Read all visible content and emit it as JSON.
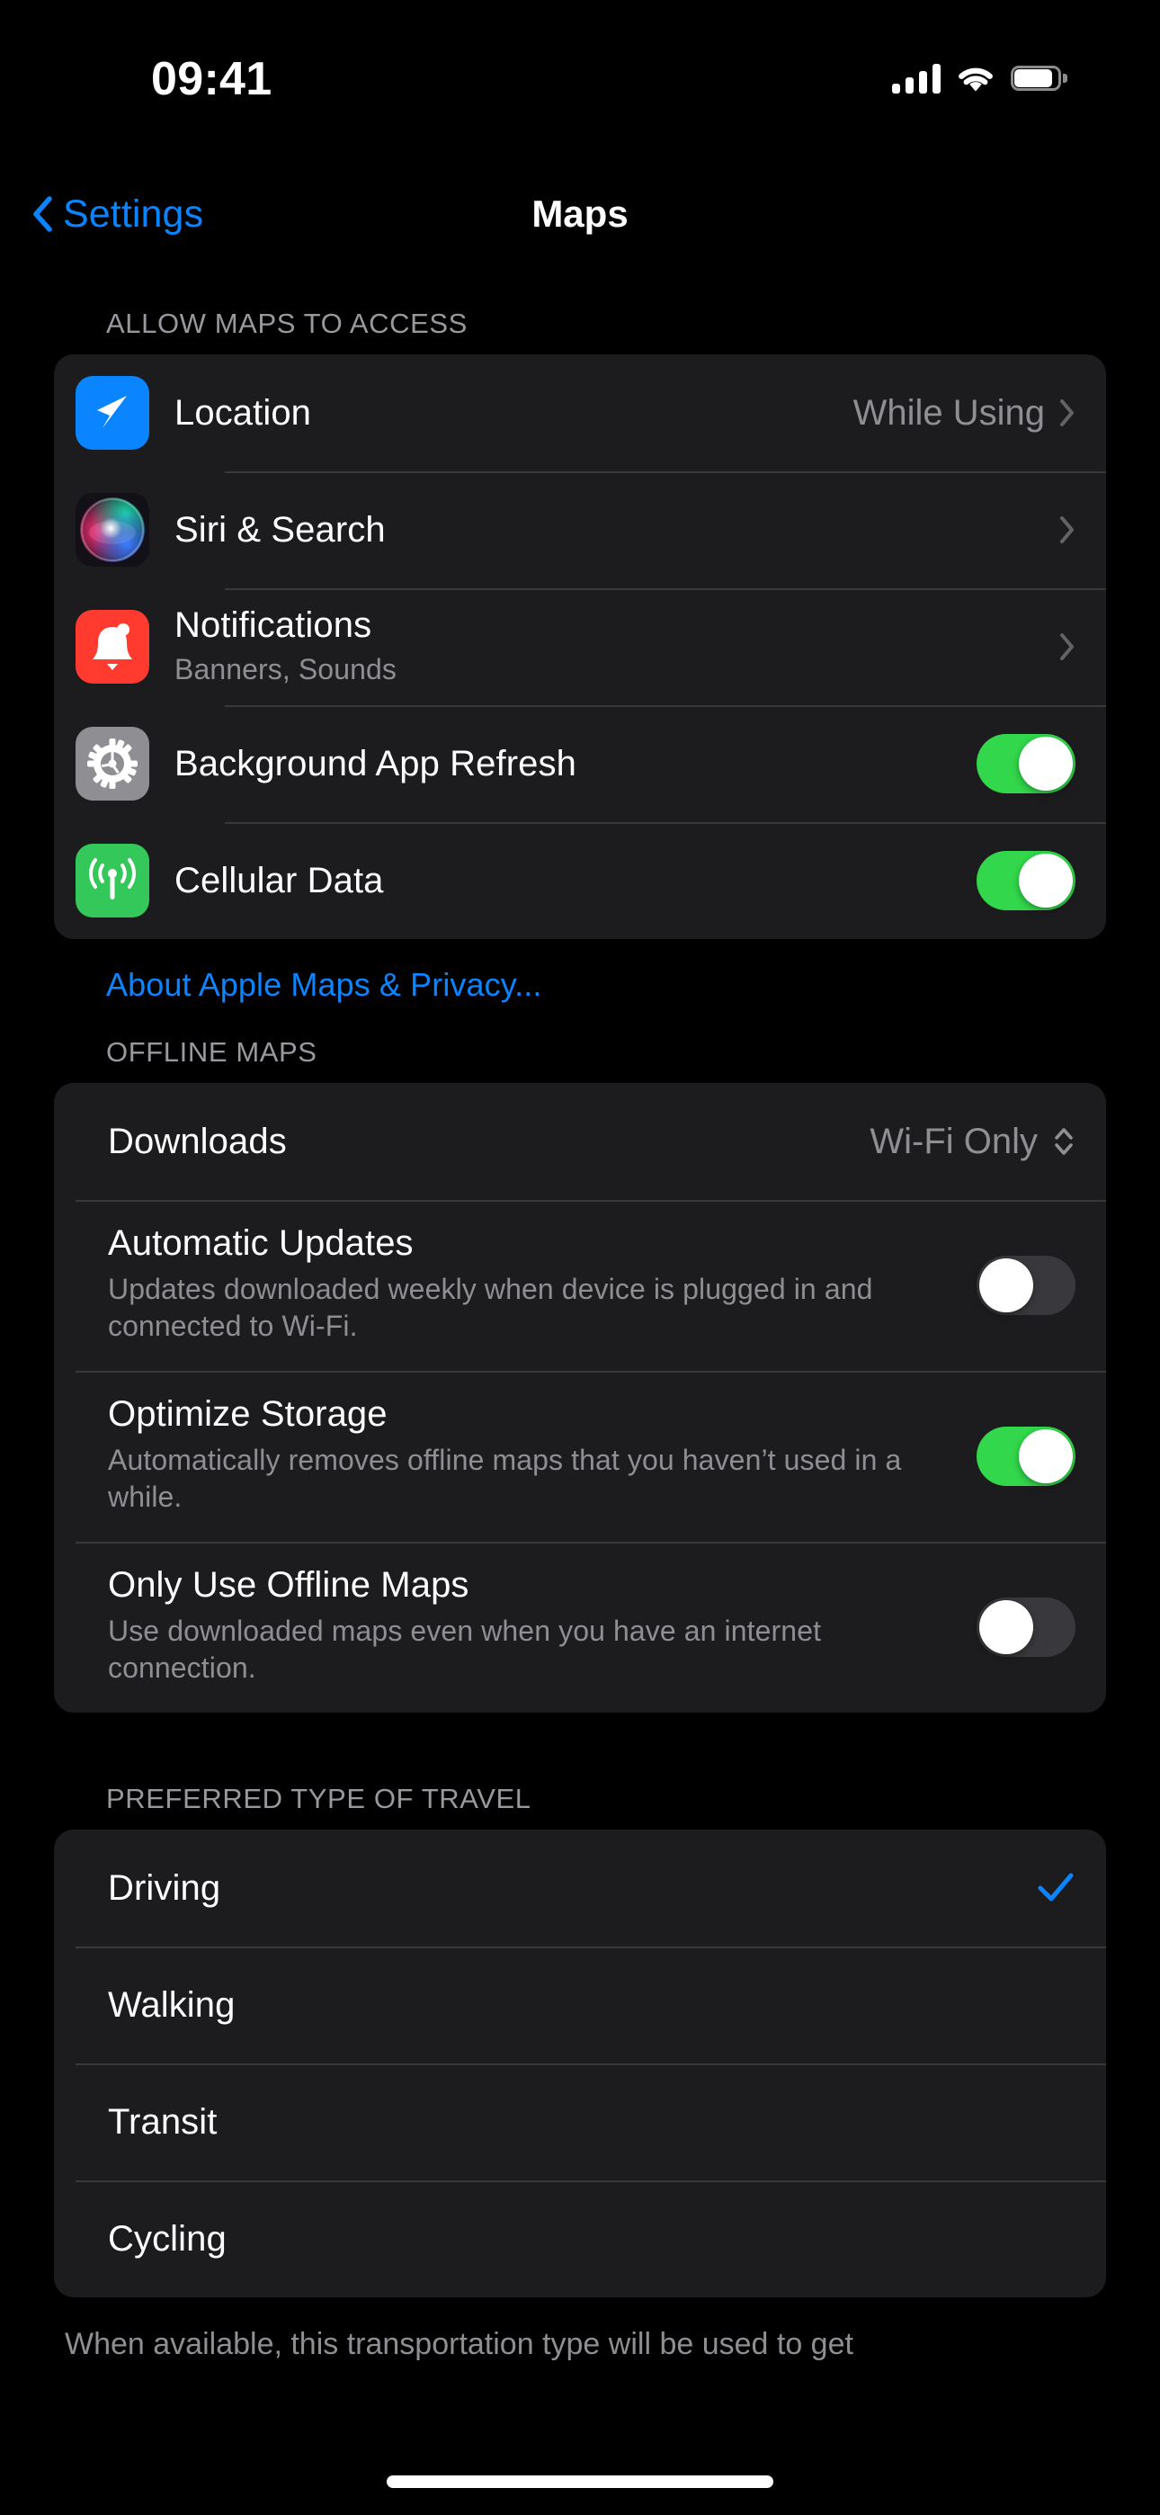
{
  "status_bar": {
    "time": "09:41",
    "cellular_icon": "cellular-signal-icon",
    "wifi_icon": "wifi-icon",
    "battery_icon": "battery-icon"
  },
  "nav": {
    "back_label": "Settings",
    "back_icon": "chevron-left-icon",
    "title": "Maps"
  },
  "colors": {
    "accent_blue": "#0a84ff",
    "toggle_on_green": "#32d74b",
    "toggle_off_gray": "#39393d",
    "card_background": "#1c1c1e",
    "page_background": "#000000",
    "secondary_text": "#8e8e93",
    "header_text": "#98989e"
  },
  "sections": {
    "allow_access": {
      "header": "ALLOW MAPS TO ACCESS",
      "rows": [
        {
          "title": "Location",
          "value": "While Using",
          "icon": "location-arrow-icon",
          "accessory": "chevron-right-icon"
        },
        {
          "title": "Siri & Search",
          "icon": "siri-orb-icon",
          "accessory": "chevron-right-icon"
        },
        {
          "title": "Notifications",
          "subtitle": "Banners, Sounds",
          "icon": "bell-icon",
          "accessory": "chevron-right-icon"
        },
        {
          "title": "Background App Refresh",
          "icon": "gear-icon",
          "accessory": "toggle",
          "toggle_on": true
        },
        {
          "title": "Cellular Data",
          "icon": "cellular-antenna-icon",
          "accessory": "toggle",
          "toggle_on": true
        }
      ],
      "privacy_link": "About Apple Maps & Privacy..."
    },
    "offline_maps": {
      "header": "OFFLINE MAPS",
      "rows": [
        {
          "title": "Downloads",
          "value": "Wi-Fi Only",
          "accessory": "up-down-chevron-icon"
        },
        {
          "title": "Automatic Updates",
          "subtitle": "Updates downloaded weekly when device is plugged in and connected to Wi-Fi.",
          "accessory": "toggle",
          "toggle_on": false
        },
        {
          "title": "Optimize Storage",
          "subtitle": "Automatically removes offline maps that you haven’t used in a while.",
          "accessory": "toggle",
          "toggle_on": true
        },
        {
          "title": "Only Use Offline Maps",
          "subtitle": "Use downloaded maps even when you have an internet connection.",
          "accessory": "toggle",
          "toggle_on": false
        }
      ]
    },
    "travel_type": {
      "header": "PREFERRED TYPE OF TRAVEL",
      "rows": [
        {
          "title": "Driving",
          "selected": true,
          "accessory": "checkmark-icon"
        },
        {
          "title": "Walking",
          "selected": false
        },
        {
          "title": "Transit",
          "selected": false
        },
        {
          "title": "Cycling",
          "selected": false
        }
      ],
      "footer": "When available, this transportation type will be used to get"
    }
  }
}
